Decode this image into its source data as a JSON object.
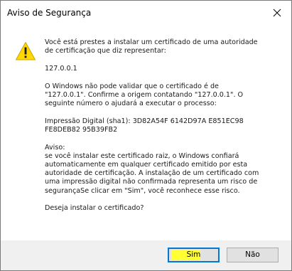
{
  "window": {
    "title": "Aviso de Segurança"
  },
  "icons": {
    "close": "close-icon",
    "warning": "warning-icon",
    "warning_color": "#ffd800"
  },
  "message": {
    "intro": "Você está prestes a instalar um certificado de uma autoridade\nde certificação que diz representar:",
    "host": "127.0.0.1",
    "validation": "O Windows não pode validar que o certificado é de\n\"127.0.0.1\". Confirme a origem contatando \"127.0.0.1\". O\nseguinte número o ajudará a executar o processo:",
    "thumbprint": "Impressão Digital (sha1): 3D82A54F 6142D97A E851EC98\nFE8DEB82 95B39FB2",
    "warning": "Aviso:\nse você instalar este certificado raiz, o Windows confiará\nautomaticamente em qualquer certificado emitido por esta\nautoridade de certificação. A instalação de um certificado com\numa impressão digital não confirmada representa um risco de\nsegurançaSe clicar em \"Sim\", você reconhece esse risco.",
    "question": "Deseja instalar o certificado?"
  },
  "buttons": {
    "yes": "Sim",
    "no": "Não",
    "highlight_color": "#ffff33",
    "focus_color": "#0078d7"
  }
}
